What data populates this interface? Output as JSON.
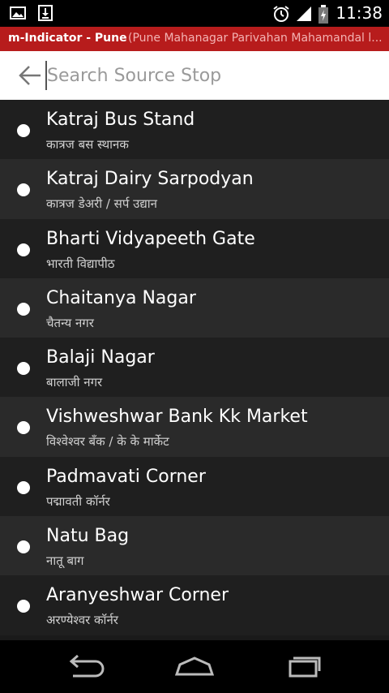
{
  "status_bar": {
    "time": "11:38",
    "left_icons": [
      "image-icon",
      "download-icon"
    ],
    "right_icons": [
      "alarm-icon",
      "signal-icon",
      "battery-icon"
    ]
  },
  "title_bar": {
    "app_name": "m-Indicator - Pune",
    "subtitle": "(Pune Mahanagar Parivahan Mahamandal l..."
  },
  "search": {
    "placeholder": "Search Source Stop",
    "value": ""
  },
  "stops": [
    {
      "name": "Katraj Bus Stand",
      "hindi": "कात्रज बस स्थानक"
    },
    {
      "name": "Katraj Dairy Sarpodyan",
      "hindi": "कात्रज डेअरी / सर्प उद्यान"
    },
    {
      "name": "Bharti Vidyapeeth Gate",
      "hindi": "भारती विद्यापीठ"
    },
    {
      "name": "Chaitanya Nagar",
      "hindi": "चैतन्य नगर"
    },
    {
      "name": "Balaji Nagar",
      "hindi": "बालाजी नगर"
    },
    {
      "name": "Vishweshwar Bank Kk Market",
      "hindi": "विश्वेश्वर बँक / के के मार्केट"
    },
    {
      "name": "Padmavati Corner",
      "hindi": "पद्मावती कॉर्नर"
    },
    {
      "name": "Natu Bag",
      "hindi": "नातू बाग"
    },
    {
      "name": "Aranyeshwar Corner",
      "hindi": "अरण्येश्वर कॉर्नर"
    }
  ],
  "nav_bar": {
    "buttons": [
      "back-icon",
      "home-icon",
      "recent-apps-icon"
    ]
  },
  "colors": {
    "title_bar_bg": "#b71c1c",
    "list_bg_dark": "#1f1f1f",
    "list_bg_light": "#2a2a2a"
  }
}
